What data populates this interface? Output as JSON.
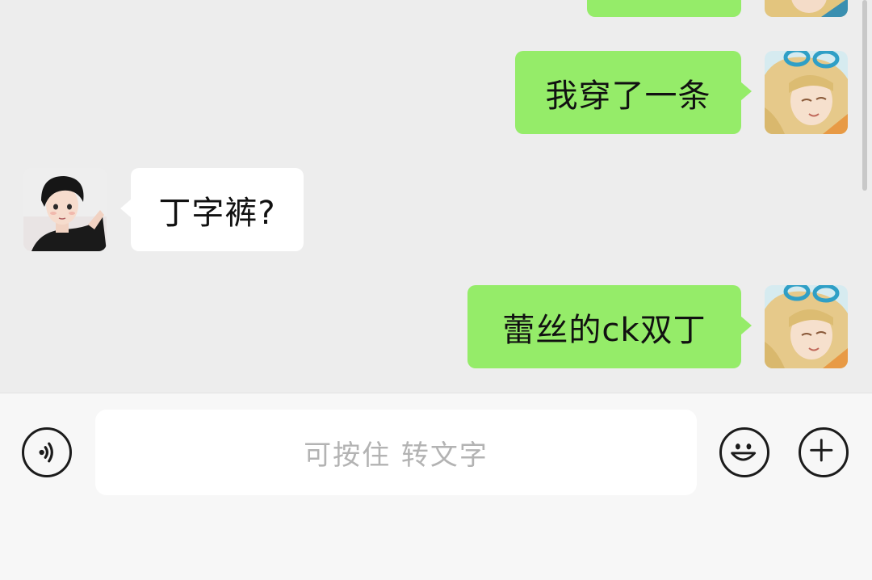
{
  "messages": [
    {
      "side": "out",
      "text": ""
    },
    {
      "side": "out",
      "text": "我穿了一条"
    },
    {
      "side": "in",
      "text": "丁字裤?"
    },
    {
      "side": "out",
      "text": "蕾丝的ck双丁"
    }
  ],
  "input": {
    "placeholder": "可按住 转文字"
  },
  "icons": {
    "voice": "voice-icon",
    "emoji": "emoji-icon",
    "add": "plus-icon"
  },
  "colors": {
    "chat_bg": "#ededed",
    "outgoing_bubble": "#95ec69",
    "incoming_bubble": "#ffffff",
    "input_bar_bg": "#f7f7f7"
  }
}
